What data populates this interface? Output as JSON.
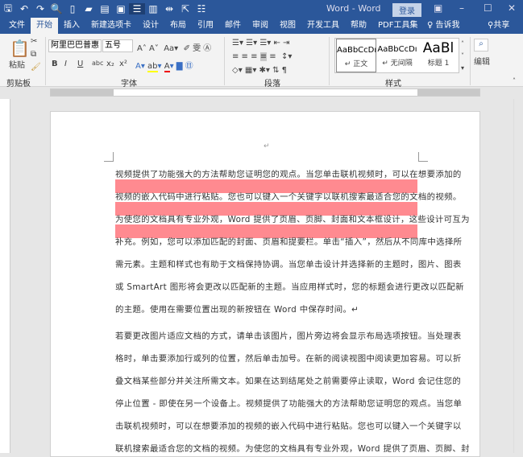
{
  "titlebar": {
    "title": "Word - Word",
    "login": "登录",
    "quick_access": [
      "save-icon",
      "undo-icon",
      "redo-icon",
      "print-preview-icon",
      "new-icon",
      "open-icon",
      "paste-icon",
      "screenshot-icon",
      "read-mode-icon"
    ]
  },
  "tabs": [
    "文件",
    "开始",
    "插入",
    "新建选项卡",
    "设计",
    "布局",
    "引用",
    "邮件",
    "审阅",
    "视图",
    "开发工具",
    "帮助",
    "PDF工具集"
  ],
  "active_tab": "开始",
  "tell_me": "告诉我",
  "share": "共享",
  "ribbon": {
    "paste": "粘贴",
    "clipboard": "剪贴板",
    "font_name": "阿里巴巴普惠",
    "font_size": "五号",
    "font_group": "字体",
    "paragraph_group": "段落",
    "styles_group": "样式",
    "edit": "编辑",
    "styles": [
      {
        "sample": "AaBbCcDı",
        "name": "↵ 正文"
      },
      {
        "sample": "AaBbCcDı",
        "name": "↵ 无间隔"
      },
      {
        "sample": "AaBl",
        "name": "标题 1"
      }
    ],
    "font_buttons": [
      "B",
      "I",
      "U",
      "abc",
      "x₂",
      "x²"
    ]
  },
  "ruler_numbers": [
    "8",
    "6",
    "4",
    "2",
    "",
    "2",
    "4",
    "6",
    "8",
    "10",
    "12",
    "14",
    "16",
    "18",
    "20",
    "22",
    "24",
    "26",
    "28",
    "30",
    "32",
    "34",
    "36",
    "38",
    "40",
    "42",
    "44",
    "46",
    "48"
  ],
  "document": {
    "paragraph_mark": "↵",
    "highlight_color": "#ff8a90",
    "lines": [
      "视频提供了功能强大的方法帮助您证明您的观点。当您单击联机视频时，可以在想要添加的",
      "视频的嵌入代码中进行粘贴。您也可以键入一个关键字以联机搜索最适合您的文档的视频。",
      "为使您的文档具有专业外观，Word 提供了页眉、页脚、封面和文本框设计，这些设计可互为",
      "补充。例如，您可以添加匹配的封面、页眉和提要栏。单击“插入”，然后从不同库中选择所",
      "需元素。主题和样式也有助于文档保持协调。当您单击设计并选择新的主题时，图片、图表",
      "或 SmartArt 图形将会更改以匹配新的主题。当应用样式时，您的标题会进行更改以匹配新",
      "的主题。使用在需要位置出现的新按钮在 Word 中保存时间。↵",
      "若要更改图片适应文档的方式，请单击该图片，图片旁边将会显示布局选项按钮。当处理表",
      "格时，单击要添加行或列的位置，然后单击加号。在新的阅读视图中阅读更加容易。可以折",
      "叠文档某些部分并关注所需文本。如果在达到结尾处之前需要停止读取，Word 会记住您的",
      "停止位置 - 即使在另一个设备上。视频提供了功能强大的方法帮助您证明您的观点。当您单",
      "击联机视频时，可以在想要添加的视频的嵌入代码中进行粘贴。您也可以键入一个关键字以",
      "联机搜索最适合您的文档的视频。为使您的文档具有专业外观，Word 提供了页眉、页脚、封"
    ]
  }
}
